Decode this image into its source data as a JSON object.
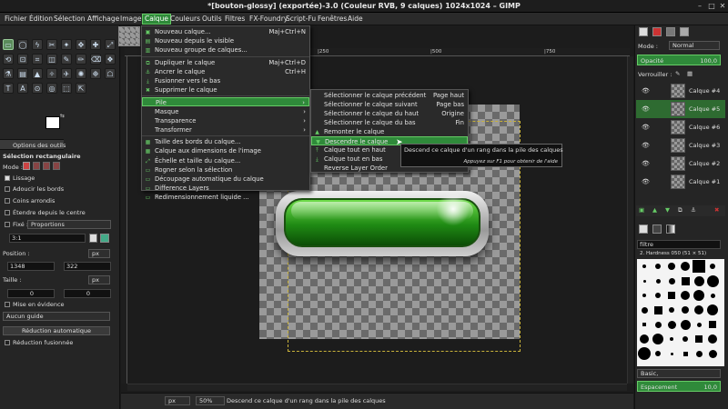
{
  "window": {
    "title": "*[bouton-glossy] (exportée)-3.0 (Couleur RVB, 9 calques) 1024x1024 – GIMP"
  },
  "menubar": [
    "Fichier",
    "Édition",
    "Sélection",
    "Affichage",
    "Image",
    "Calque",
    "Couleurs",
    "Outils",
    "Filtres",
    "FX-Foundry",
    "Script-Fu",
    "Fenêtres",
    "Aide"
  ],
  "calque_menu": [
    {
      "label": "Nouveau calque...",
      "shortcut": "Maj+Ctrl+N"
    },
    {
      "label": "Nouveau depuis le visible",
      "shortcut": ""
    },
    {
      "label": "Nouveau groupe de calques...",
      "shortcut": ""
    },
    {
      "label": "Dupliquer le calque",
      "shortcut": "Maj+Ctrl+D"
    },
    {
      "label": "Ancrer le calque",
      "shortcut": "Ctrl+H"
    },
    {
      "label": "Fusionner vers le bas",
      "shortcut": ""
    },
    {
      "label": "Supprimer le calque",
      "shortcut": ""
    },
    {
      "label": "Pile",
      "shortcut": ""
    },
    {
      "label": "Masque",
      "shortcut": ""
    },
    {
      "label": "Transparence",
      "shortcut": ""
    },
    {
      "label": "Transformer",
      "shortcut": ""
    },
    {
      "label": "Taille des bords du calque...",
      "shortcut": ""
    },
    {
      "label": "Calque aux dimensions de l'image",
      "shortcut": ""
    },
    {
      "label": "Échelle et taille du calque...",
      "shortcut": ""
    },
    {
      "label": "Rogner selon la sélection",
      "shortcut": ""
    },
    {
      "label": "Découpage automatique du calque",
      "shortcut": ""
    },
    {
      "label": "Difference Layers",
      "shortcut": ""
    },
    {
      "label": "Redimensionnement liquide ...",
      "shortcut": ""
    }
  ],
  "pile_menu": [
    {
      "label": "Sélectionner le calque précédent",
      "shortcut": "Page haut"
    },
    {
      "label": "Sélectionner le calque suivant",
      "shortcut": "Page bas"
    },
    {
      "label": "Sélectionner le calque du haut",
      "shortcut": "Origine"
    },
    {
      "label": "Sélectionner le calque du bas",
      "shortcut": "Fin"
    },
    {
      "label": "Remonter le calque",
      "shortcut": ""
    },
    {
      "label": "Descendre le calque",
      "shortcut": ""
    },
    {
      "label": "Calque tout en haut",
      "shortcut": ""
    },
    {
      "label": "Calque tout en bas",
      "shortcut": ""
    },
    {
      "label": "Reverse Layer Order",
      "shortcut": ""
    }
  ],
  "tooltip": {
    "main": "Descend ce calque d'un rang dans la pile des calques",
    "hint": "Appuyez sur F1 pour obtenir de l'aide"
  },
  "tool_options": {
    "tab": "Options des outils",
    "title": "Sélection rectangulaire",
    "mode": "Mode :",
    "lissage": "Lissage",
    "adoucir": "Adoucir les bords",
    "coins": "Coins arrondis",
    "etendre": "Étendre depuis le centre",
    "fixe": "Fixé :",
    "fixe_val": "Proportions",
    "ratio": "3:1",
    "position": "Position :",
    "px": "px",
    "pos_x": "1348",
    "pos_y": "322",
    "taille": "Taille :",
    "t_x": "0",
    "t_y": "0",
    "mise": "Mise en évidence",
    "guide": "Aucun guide",
    "reduction": "Réduction automatique",
    "fusion": "Réduction fusionnée"
  },
  "rulers": [
    "|250",
    "|500",
    "|750"
  ],
  "status": {
    "unit": "px",
    "zoom": "50%",
    "message": "Descend ce calque d'un rang dans la pile des calques"
  },
  "layers_panel": {
    "mode_label": "Mode :",
    "mode_val": "Normal",
    "opacity_label": "Opacité",
    "opacity_val": "100,0",
    "lock_label": "Verrouiller :",
    "layers": [
      "Calque #4",
      "Calque #5",
      "Calque #6",
      "Calque #3",
      "Calque #2",
      "Calque #1"
    ],
    "active_index": 1
  },
  "brushes": {
    "filter": "filtre",
    "name": "2. Hardness 050 (51 × 51)",
    "preset": "Basic,",
    "spacing_label": "Espacement",
    "spacing_val": "10,0"
  }
}
